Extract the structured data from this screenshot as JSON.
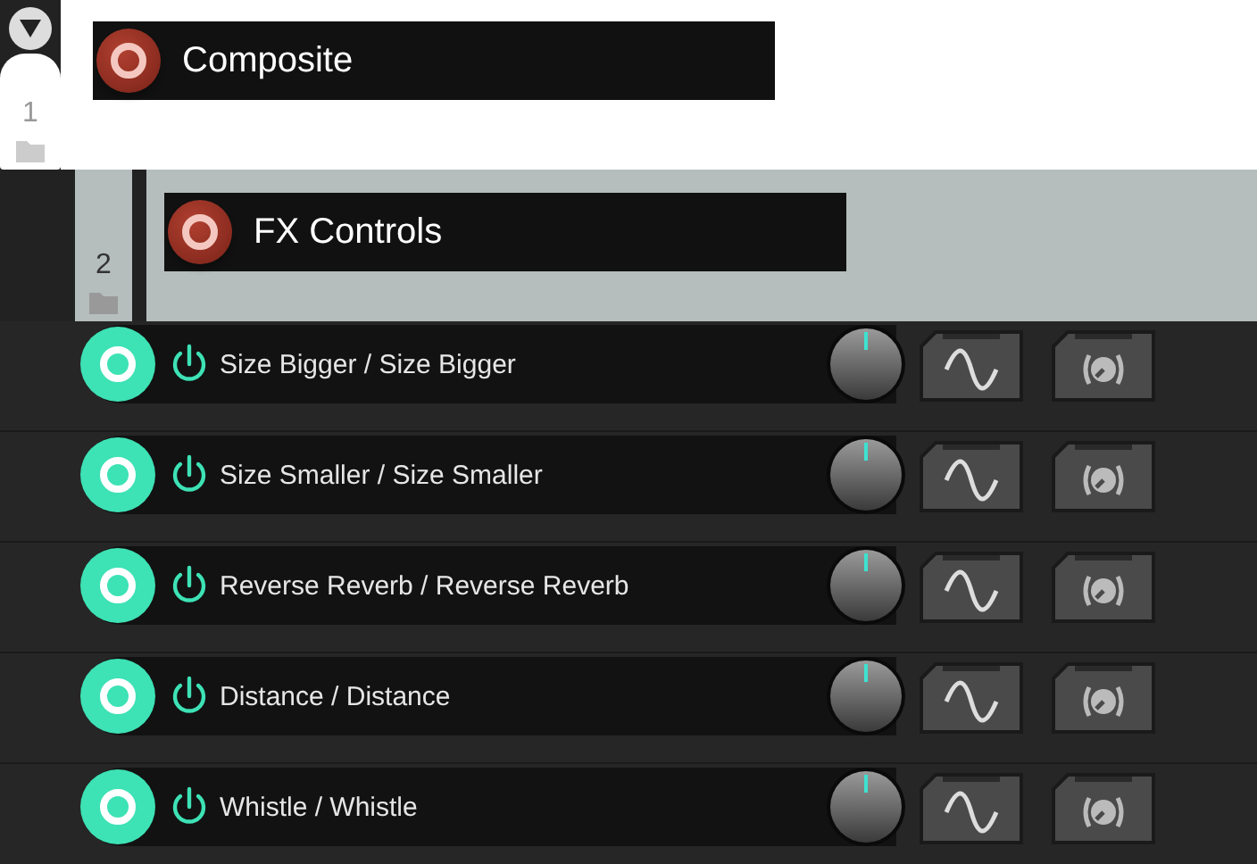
{
  "groups": [
    {
      "number": "1",
      "title": "Composite",
      "selected": true,
      "enabled": true
    },
    {
      "number": "2",
      "title": "FX Controls",
      "selected": false,
      "enabled": true
    }
  ],
  "controls": [
    {
      "label": "Size Bigger / Size Bigger",
      "enabled": true
    },
    {
      "label": "Size Smaller / Size Smaller",
      "enabled": true
    },
    {
      "label": "Reverse Reverb / Reverse Reverb",
      "enabled": true
    },
    {
      "label": "Distance / Distance",
      "enabled": true
    },
    {
      "label": "Whistle / Whistle",
      "enabled": true
    }
  ]
}
